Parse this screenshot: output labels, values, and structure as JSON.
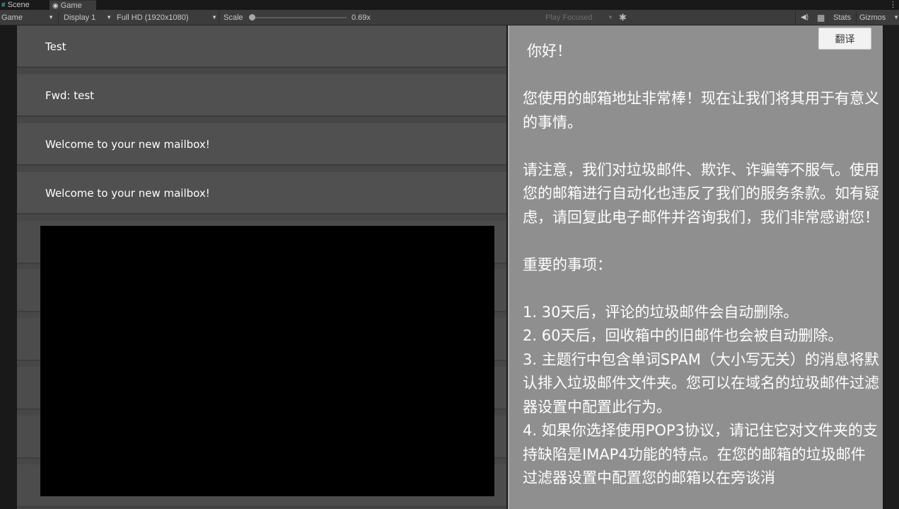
{
  "tabs": [
    {
      "label": "Scene",
      "icon": "hash-grid-icon"
    },
    {
      "label": "Game",
      "icon": "gamepad-icon"
    }
  ],
  "toolbar": {
    "game_dropdown": "Game",
    "display_dropdown": "Display 1",
    "resolution_dropdown": "Full HD (1920x1080)",
    "scale_label": "Scale",
    "scale_value": "0.69x",
    "play_mode_dropdown": "Play Focused",
    "stats_label": "Stats",
    "gizmos_label": "Gizmos"
  },
  "mail_list": [
    {
      "subject": "Test"
    },
    {
      "subject": "Fwd: test"
    },
    {
      "subject": "Welcome to your new mailbox!"
    },
    {
      "subject": "Welcome to your new mailbox!"
    }
  ],
  "mail_view": {
    "translate_button": "翻译",
    "greeting": "你好！",
    "para1": "您使用的邮箱地址非常棒！现在让我们将其用于有意义的事情。",
    "para2": "请注意，我们对垃圾邮件、欺诈、诈骗等不服气。使用您的邮箱进行自动化也违反了我们的服务条款。如有疑虑，请回复此电子邮件并咨询我们，我们非常感谢您！",
    "heading": "重要的事项：",
    "item1": "1. 30天后，评论的垃圾邮件会自动删除。",
    "item2": "2. 60天后，回收箱中的旧邮件也会被自动删除。",
    "item3": "3. 主题行中包含单词SPAM（大小写无关）的消息将默认排入垃圾邮件文件夹。您可以在域名的垃圾邮件过滤器设置中配置此行为。",
    "item4": "4. 如果你选择使用POP3协议，请记住它对文件夹的支持缺陷是IMAP4功能的特点。在您的邮箱的垃圾邮件过滤器设置中配置您的邮箱以在旁谈消"
  }
}
